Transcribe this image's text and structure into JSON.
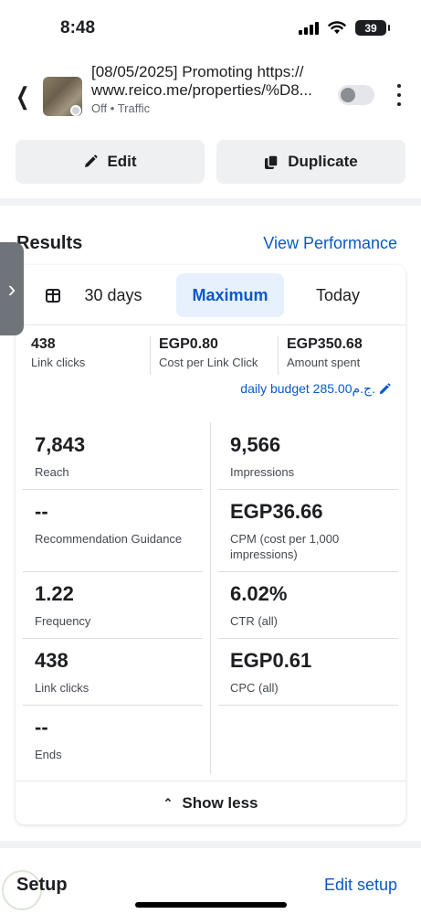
{
  "status_bar": {
    "time": "8:48",
    "battery": "39"
  },
  "header": {
    "title_line1": "[08/05/2025] Promoting https://",
    "title_line2": "www.reico.me/properties/%D8...",
    "status": "Off",
    "separator": "•",
    "objective": "Traffic"
  },
  "actions": {
    "edit": "Edit",
    "duplicate": "Duplicate"
  },
  "results": {
    "title": "Results",
    "view_performance": "View Performance",
    "ranges": [
      "30 days",
      "Maximum",
      "Today"
    ],
    "selected_range": "Maximum",
    "summary": [
      {
        "value": "438",
        "label": "Link clicks"
      },
      {
        "value": "EGP0.80",
        "label": "Cost per Link Click"
      },
      {
        "value": "EGP350.68",
        "label": "Amount spent"
      }
    ],
    "daily_budget": "daily budget 285.00ج.م.",
    "metrics_left": [
      {
        "value": "7,843",
        "label": "Reach"
      },
      {
        "value": "--",
        "label": "Recommendation Guidance"
      },
      {
        "value": "1.22",
        "label": "Frequency"
      },
      {
        "value": "438",
        "label": "Link clicks"
      },
      {
        "value": "--",
        "label": "Ends"
      }
    ],
    "metrics_right": [
      {
        "value": "9,566",
        "label": "Impressions"
      },
      {
        "value": "EGP36.66",
        "label": "CPM (cost per 1,000 impressions)"
      },
      {
        "value": "6.02%",
        "label": "CTR (all)"
      },
      {
        "value": "EGP0.61",
        "label": "CPC (all)"
      }
    ],
    "show_less": "Show less"
  },
  "setup": {
    "title": "Setup",
    "edit_setup": "Edit setup"
  },
  "colors": {
    "accent": "#0a58ca",
    "selected_bg": "#e7f0fd"
  }
}
